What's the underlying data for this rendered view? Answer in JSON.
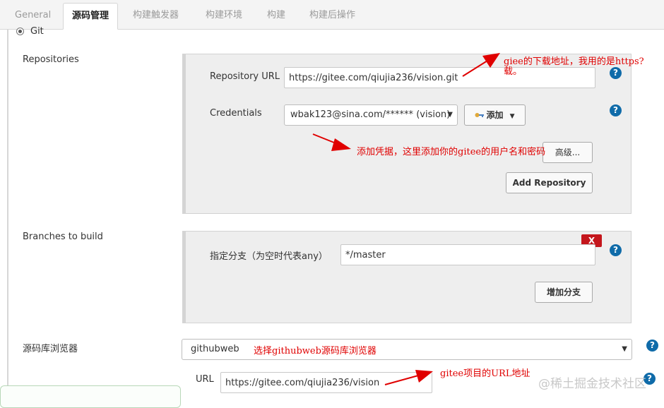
{
  "tabs": [
    {
      "label": "General",
      "active": false
    },
    {
      "label": "源码管理",
      "active": true
    },
    {
      "label": "构建触发器",
      "active": false
    },
    {
      "label": "构建环境",
      "active": false
    },
    {
      "label": "构建",
      "active": false
    },
    {
      "label": "构建后操作",
      "active": false
    }
  ],
  "scm": {
    "git_label": "Git",
    "repositories_label": "Repositories",
    "repo_url_label": "Repository URL",
    "repo_url_value": "https://gitee.com/qiujia236/vision.git",
    "credentials_label": "Credentials",
    "credentials_value": "wbak123@sina.com/****** (vision)",
    "add_label": "添加",
    "advanced_label": "高级...",
    "add_repository_label": "Add Repository",
    "branches_label": "Branches to build",
    "branch_spec_label": "指定分支（为空时代表any）",
    "branch_spec_value": "*/master",
    "delete_branch_label": "X",
    "add_branch_label": "增加分支",
    "repo_browser_label": "源码库浏览器",
    "repo_browser_value": "githubweb",
    "browser_url_label": "URL",
    "browser_url_value": "https://gitee.com/qiujia236/vision",
    "help_glyph": "?"
  },
  "annotations": {
    "download_line1": "giee的下载地址，我用的是https?",
    "download_line2": "载。",
    "credentials_note": "添加凭据，这里添加你的gitee的用户名和密码",
    "browser_note": "选择githubweb源码库浏览器",
    "url_note": "gitee项目的URL地址"
  },
  "watermark": "@稀土掘金技术社区",
  "colors": {
    "help_blue": "#0f6ba9",
    "delete_red": "#c4161c",
    "annotation_red": "#e00000"
  }
}
